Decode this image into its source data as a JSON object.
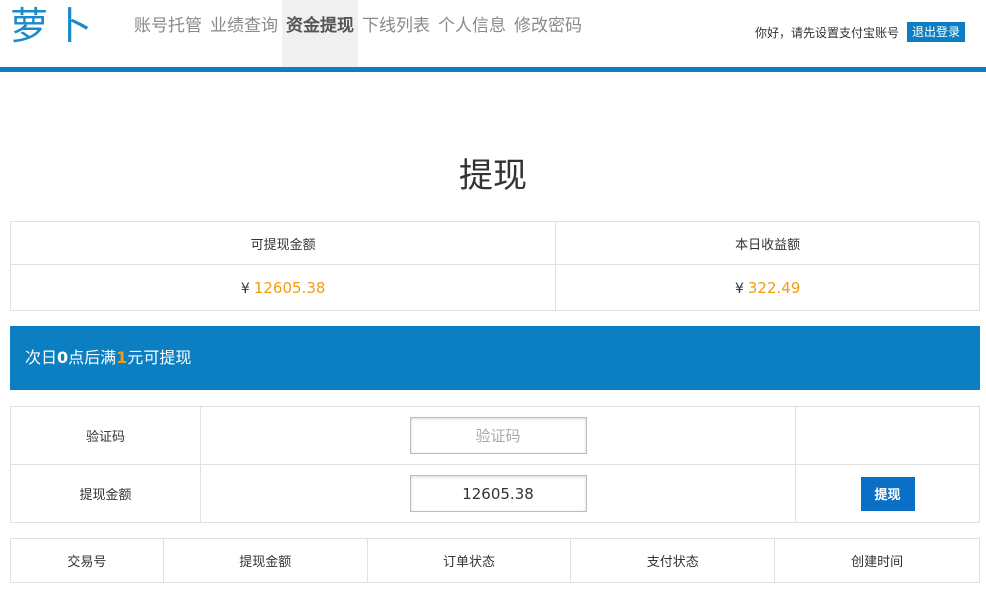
{
  "header": {
    "logo": "萝卜",
    "nav": [
      "账号托管",
      "业绩查询",
      "资金提现",
      "下线列表",
      "个人信息",
      "修改密码"
    ],
    "active_nav_index": 2,
    "user_message": "你好，请先设置支付宝账号",
    "logout_label": "退出登录",
    "accent_color": "#0b7fc1"
  },
  "page_title": "提现",
  "balance": {
    "withdrawable_label": "可提现金额",
    "today_income_label": "本日收益额",
    "currency": "¥",
    "withdrawable_amount": "12605.38",
    "today_income_amount": "322.49"
  },
  "notice": {
    "part1": "次日",
    "hour": "0",
    "part2": "点后满",
    "min": "1",
    "part3": "元可提现"
  },
  "form": {
    "captcha_label": "验证码",
    "captcha_placeholder": "验证码",
    "amount_label": "提现金额",
    "amount_value": "12605.38",
    "submit_label": "提现"
  },
  "records": {
    "columns": [
      "交易号",
      "提现金额",
      "订单状态",
      "支付状态",
      "创建时间"
    ]
  }
}
